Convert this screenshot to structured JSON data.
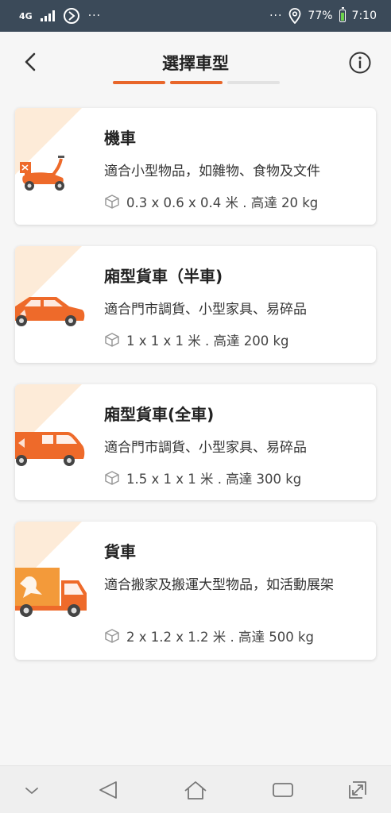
{
  "status_bar": {
    "network": "4G",
    "dots_left": "···",
    "dots_right": "···",
    "battery": "77%",
    "time": "7:10"
  },
  "header": {
    "title": "選擇車型",
    "progress_steps_completed": 2,
    "progress_steps_total": 3
  },
  "vehicles": [
    {
      "name": "機車",
      "description": "適合小型物品，如雜物、食物及文件",
      "spec": "0.3 x 0.6 x 0.4 米 . 高達 20 kg",
      "icon": "scooter-icon"
    },
    {
      "name": "廂型貨車（半車)",
      "description": "適合門市調貨、小型家具、易碎品",
      "spec": "1 x 1 x 1 米 . 高達 200 kg",
      "icon": "car-icon"
    },
    {
      "name": "廂型貨車(全車)",
      "description": "適合門市調貨、小型家具、易碎品",
      "spec": "1.5 x 1 x 1 米 . 高達 300 kg",
      "icon": "van-icon"
    },
    {
      "name": "貨車",
      "description": "適合搬家及搬運大型物品，如活動展架",
      "spec": "2 x 1.2 x 1.2 米 . 高達 500 kg",
      "icon": "truck-icon"
    }
  ],
  "colors": {
    "accent": "#e8662a",
    "vehicle_orange": "#ee6a2a",
    "status_bar": "#3b4a59",
    "corner_tint": "#fdebd8"
  },
  "nav_bar": {
    "icons": [
      "chevron-down-icon",
      "back-triangle-icon",
      "home-icon",
      "recents-icon",
      "expand-icon"
    ]
  }
}
